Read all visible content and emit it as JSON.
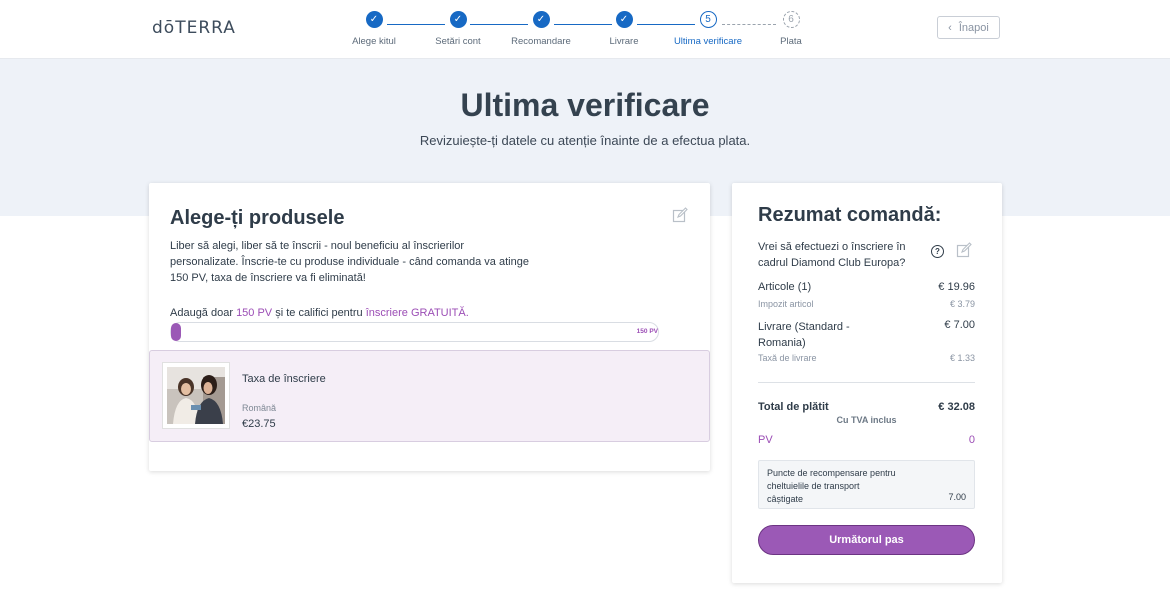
{
  "header": {
    "logo": "dōTERRA",
    "back_label": "Înapoi",
    "steps": [
      {
        "label": "Alege kitul",
        "status": "done"
      },
      {
        "label": "Setări cont",
        "status": "done"
      },
      {
        "label": "Recomandare",
        "status": "done"
      },
      {
        "label": "Livrare",
        "status": "done"
      },
      {
        "label": "Ultima verificare",
        "status": "current",
        "number": "5"
      },
      {
        "label": "Plata",
        "status": "future",
        "number": "6"
      }
    ]
  },
  "hero": {
    "title": "Ultima verificare",
    "subtitle": "Revizuiește-ți datele cu atenție înainte de a efectua plata."
  },
  "products": {
    "title": "Alege-ți produsele",
    "description": "Liber să alegi, liber să te înscrii - noul beneficiu al înscrierilor personalizate. Înscrie-te cu produse individuale - când comanda va atinge 150 PV, taxa de înscriere va fi eliminată!",
    "pv_prefix": "Adaugă doar ",
    "pv_amount": "150 PV",
    "pv_middle": " și te califici pentru ",
    "pv_free": "înscriere GRATUITĂ",
    "pv_suffix": ".",
    "progress_end_label": "150 PV",
    "progress_fraction": 0.02,
    "item": {
      "name": "Taxa de înscriere",
      "language": "Română",
      "price": "€23.75"
    }
  },
  "summary": {
    "title": "Rezumat comandă:",
    "question": "Vrei să efectuezi o înscriere în cadrul Diamond Club Europa?",
    "help_glyph": "?",
    "articles_label": "Articole (1)",
    "articles_value": "€ 19.96",
    "article_tax_label": "Impozit articol",
    "article_tax_value": "€ 3.79",
    "shipping_label": "Livrare (Standard - Romania)",
    "shipping_value": "€ 7.00",
    "shipping_tax_label": "Taxă de livrare",
    "shipping_tax_value": "€ 1.33",
    "total_label": "Total de plătit",
    "total_value": "€ 32.08",
    "vat_note": "Cu TVA inclus",
    "pv_label": "PV",
    "pv_value": "0",
    "reward_text": "Puncte de recompensare pentru cheltuielile de transport câștigate",
    "reward_value": "7.00",
    "next_label": "Următorul pas"
  },
  "colors": {
    "accent_blue": "#1769c4",
    "accent_purple": "#9b59b6",
    "hero_bg": "#eef2f8"
  }
}
